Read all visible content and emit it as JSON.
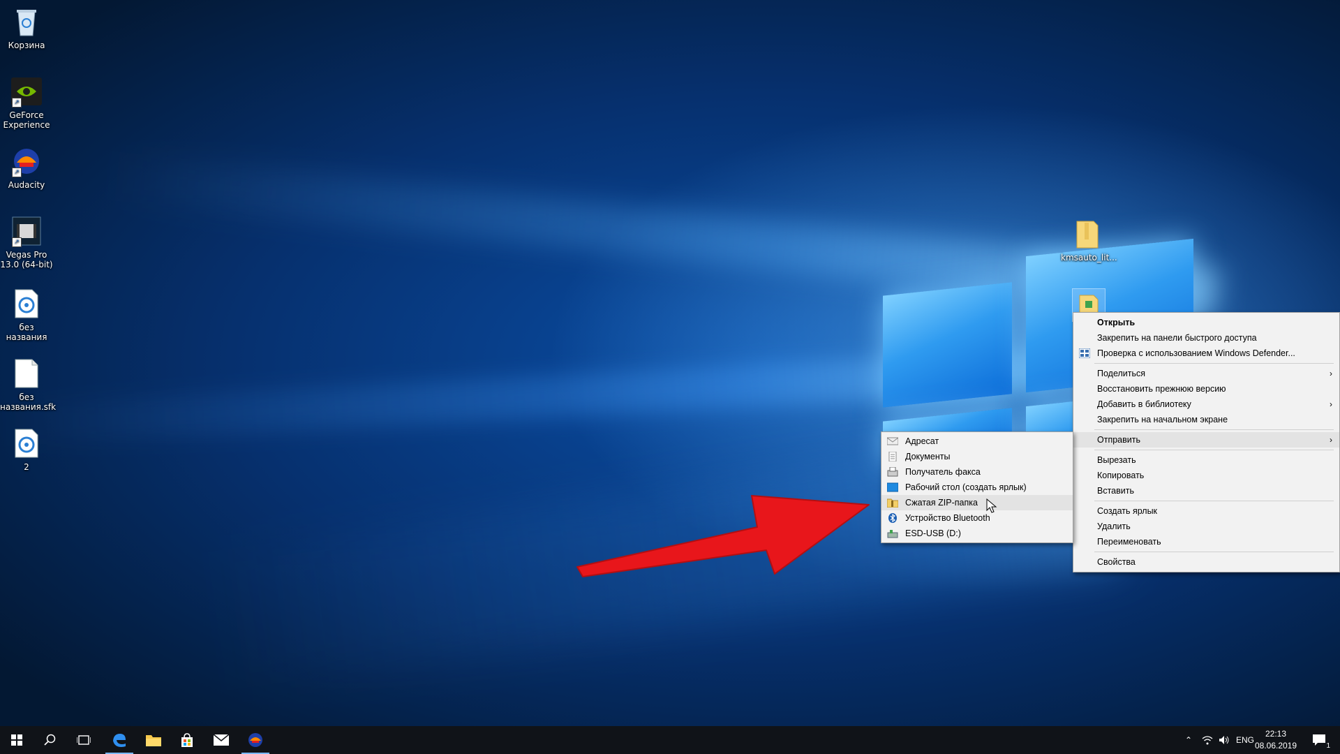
{
  "desktop": {
    "icons": [
      {
        "label": "Корзина",
        "icon": "recycle-bin-icon"
      },
      {
        "label": "GeForce Experience",
        "icon": "nvidia-icon"
      },
      {
        "label": "Audacity",
        "icon": "audacity-icon"
      },
      {
        "label": "Vegas Pro 13.0 (64-bit)",
        "icon": "vegas-icon"
      },
      {
        "label": "без названия",
        "icon": "disc-file-icon"
      },
      {
        "label": "без названия.sfk",
        "icon": "blank-file-icon"
      },
      {
        "label": "2",
        "icon": "disc-file-icon"
      },
      {
        "label": "kmsauto_lit...",
        "icon": "folder-zip-icon"
      }
    ]
  },
  "context_menu": {
    "items": [
      {
        "label": "Открыть",
        "bold": true
      },
      {
        "label": "Закрепить на панели быстрого доступа"
      },
      {
        "label": "Проверка с использованием Windows Defender...",
        "icon": "defender-icon"
      },
      {
        "label": "Поделиться",
        "submenu": true
      },
      {
        "label": "Восстановить прежнюю версию"
      },
      {
        "label": "Добавить в библиотеку",
        "submenu": true
      },
      {
        "label": "Закрепить на начальном экране"
      },
      {
        "label": "Отправить",
        "submenu": true,
        "highlighted": true
      },
      {
        "label": "Вырезать"
      },
      {
        "label": "Копировать"
      },
      {
        "label": "Вставить"
      },
      {
        "label": "Создать ярлык"
      },
      {
        "label": "Удалить"
      },
      {
        "label": "Переименовать"
      },
      {
        "label": "Свойства"
      }
    ]
  },
  "send_to_menu": {
    "items": [
      {
        "label": "Адресат",
        "icon": "mail-recipient-icon"
      },
      {
        "label": "Документы",
        "icon": "documents-icon"
      },
      {
        "label": "Получатель факса",
        "icon": "fax-icon"
      },
      {
        "label": "Рабочий стол (создать ярлык)",
        "icon": "desktop-icon"
      },
      {
        "label": "Сжатая ZIP-папка",
        "icon": "zip-folder-icon",
        "highlighted": true
      },
      {
        "label": "Устройство Bluetooth",
        "icon": "bluetooth-icon"
      },
      {
        "label": "ESD-USB (D:)",
        "icon": "usb-drive-icon"
      }
    ]
  },
  "taskbar": {
    "language": "ENG",
    "time": "22:13",
    "date": "08.06.2019",
    "notification_count": "1"
  },
  "colors": {
    "annotation_arrow": "#e8161b",
    "menu_bg": "#f2f2f2",
    "menu_highlight": "#e3e3e3",
    "taskbar_bg": "#101318"
  }
}
